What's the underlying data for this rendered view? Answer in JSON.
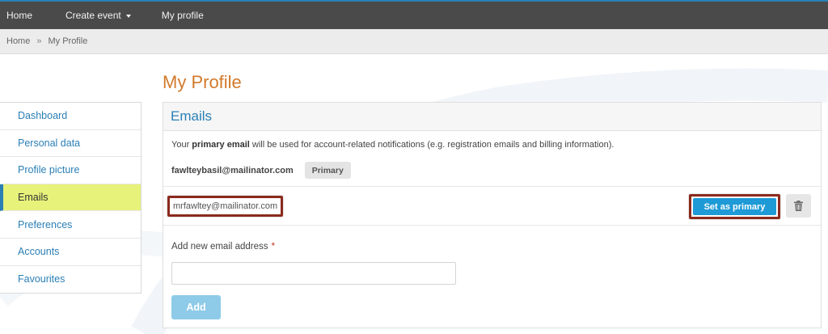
{
  "topnav": {
    "home": "Home",
    "create_event": "Create event",
    "my_profile": "My profile"
  },
  "breadcrumb": {
    "home": "Home",
    "separator": "»",
    "current": "My Profile"
  },
  "page_title": "My Profile",
  "sidebar": {
    "items": [
      {
        "label": "Dashboard",
        "active": false
      },
      {
        "label": "Personal data",
        "active": false
      },
      {
        "label": "Profile picture",
        "active": false
      },
      {
        "label": "Emails",
        "active": true
      },
      {
        "label": "Preferences",
        "active": false
      },
      {
        "label": "Accounts",
        "active": false
      },
      {
        "label": "Favourites",
        "active": false
      }
    ]
  },
  "emails_panel": {
    "title": "Emails",
    "notice_before": "Your ",
    "notice_bold": "primary email",
    "notice_after": " will be used for account-related notifications (e.g. registration emails and billing information).",
    "primary_email": "fawlteybasil@mailinator.com",
    "primary_badge": "Primary",
    "secondary_email": "mrfawltey@mailinator.com",
    "set_primary_label": "Set as primary",
    "delete_icon": "trash-icon",
    "add_label": "Add new email address",
    "required_marker": "*",
    "add_input_value": "",
    "add_button_label": "Add"
  },
  "colors": {
    "nav_bg": "#4a4a4a",
    "accent_blue": "#2a7fb5",
    "title_orange": "#d27a2c",
    "active_highlight": "#e6f27a",
    "button_blue": "#1e9ad6",
    "annotation_red": "#8b2a1d"
  }
}
